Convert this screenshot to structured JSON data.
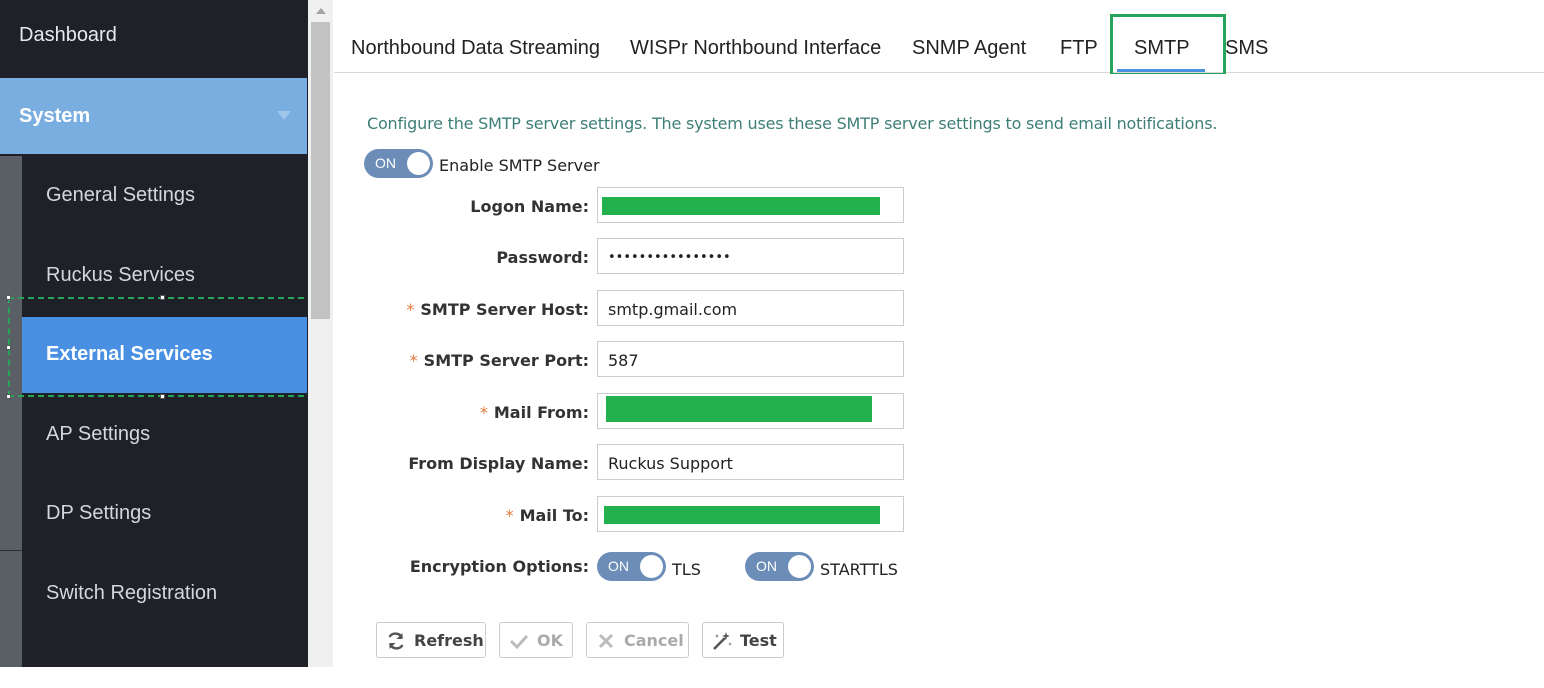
{
  "sidebar": {
    "dashboard": "Dashboard",
    "system": "System",
    "items": [
      {
        "label": "General Settings"
      },
      {
        "label": "Ruckus Services"
      },
      {
        "label": "External Services"
      },
      {
        "label": "AP Settings"
      },
      {
        "label": "DP Settings"
      },
      {
        "label": "Switch Registration"
      }
    ],
    "active_item": "External Services"
  },
  "tabs": [
    {
      "label": "Northbound Data Streaming"
    },
    {
      "label": "WISPr Northbound Interface"
    },
    {
      "label": "SNMP Agent"
    },
    {
      "label": "FTP"
    },
    {
      "label": "SMTP"
    },
    {
      "label": "SMS"
    }
  ],
  "active_tab": "SMTP",
  "smtp": {
    "description": "Configure the SMTP server settings. The system uses these SMTP server settings to send email notifications.",
    "enable_toggle": "ON",
    "enable_label": "Enable SMTP Server",
    "fields": {
      "logon_name": {
        "label": "Logon Name:",
        "value": ""
      },
      "password": {
        "label": "Password:",
        "value": "••••••••••••••••"
      },
      "host": {
        "label": "SMTP Server Host:",
        "value": "smtp.gmail.com"
      },
      "port": {
        "label": "SMTP Server Port:",
        "value": "587"
      },
      "mail_from": {
        "label": "Mail From:",
        "value": ""
      },
      "display_name": {
        "label": "From Display Name:",
        "value": "Ruckus Support"
      },
      "mail_to": {
        "label": "Mail To:",
        "value": ""
      }
    },
    "required_mark": "*",
    "encryption": {
      "label": "Encryption Options:",
      "tls_toggle": "ON",
      "tls_label": "TLS",
      "starttls_toggle": "ON",
      "starttls_label": "STARTTLS"
    }
  },
  "buttons": {
    "refresh": "Refresh",
    "ok": "OK",
    "cancel": "Cancel",
    "test": "Test"
  },
  "colors": {
    "sidebar_bg": "#1e2127",
    "system_header": "#7aaee0",
    "active_item": "#4a90e2",
    "toggle_on": "#6b8db8",
    "highlight_green": "#27a35a",
    "required_star": "#e07b39",
    "description_text": "#3d7f77"
  }
}
